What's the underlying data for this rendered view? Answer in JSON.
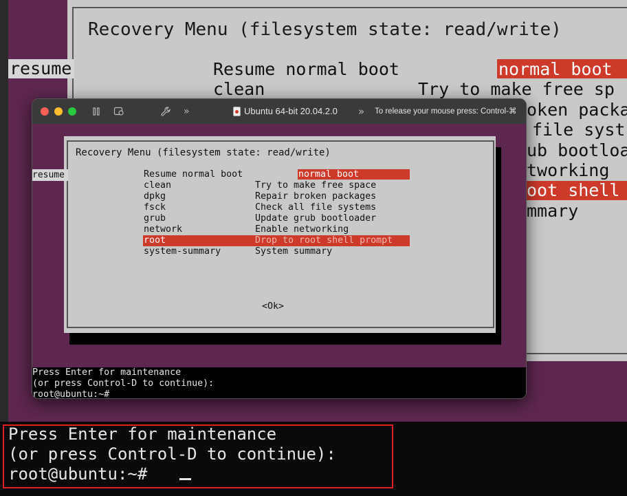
{
  "background_vm": {
    "dialog_title": "Recovery Menu (filesystem state: read/write)",
    "resume_label": "resume",
    "rows": [
      {
        "name": "Resume normal boot",
        "desc": "normal boot"
      },
      {
        "name": "clean",
        "desc": "Try to make free sp"
      },
      {
        "name": "",
        "desc": "oken packa"
      },
      {
        "name": "",
        "desc": "file syst"
      },
      {
        "name": "",
        "desc": "ub bootloa"
      },
      {
        "name": "",
        "desc": "tworking"
      },
      {
        "name": "",
        "desc": "oot shell"
      },
      {
        "name": "",
        "desc": "mmary"
      }
    ],
    "console_lines": [
      "Press Enter for maintenance",
      "(or press Control-D to continue):",
      "root@ubuntu:~# "
    ]
  },
  "vm_window": {
    "title": "Ubuntu 64-bit 20.04.2.0",
    "release_hint": "To release your mouse press: Control-⌘",
    "toolbar_icons": [
      "pause-icon",
      "snapshot-icon",
      "wrench-icon",
      "chevron-right-icon"
    ],
    "colors": {
      "close": "#ff5f57",
      "minimize": "#febc2e",
      "zoom": "#28c840",
      "accent": "#cd3a2a",
      "purple": "#5e2750"
    },
    "dialog_title": "Recovery Menu (filesystem state: read/write)",
    "resume_label": "resume",
    "menu_items": [
      {
        "name": "Resume normal boot",
        "desc": "normal boot"
      },
      {
        "name": "clean",
        "desc": "Try to make free space"
      },
      {
        "name": "dpkg",
        "desc": "Repair broken packages"
      },
      {
        "name": "fsck",
        "desc": "Check all file systems"
      },
      {
        "name": "grub",
        "desc": "Update grub bootloader"
      },
      {
        "name": "network",
        "desc": "Enable networking"
      },
      {
        "name": "root",
        "desc": "Drop to root shell prompt"
      },
      {
        "name": "system-summary",
        "desc": "System summary"
      }
    ],
    "ok_button": "<Ok>",
    "console_lines": [
      "Press Enter for maintenance",
      "(or press Control-D to continue):",
      "root@ubuntu:~#"
    ]
  }
}
